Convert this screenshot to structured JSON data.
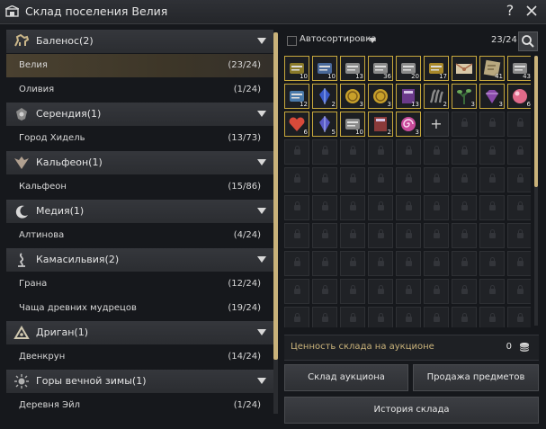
{
  "window": {
    "title": "Склад поселения Велия"
  },
  "regions": [
    {
      "name": "Баленос(2)",
      "icon": "horse-icon",
      "towns": [
        {
          "name": "Велия",
          "count": "(23/24)",
          "selected": true
        },
        {
          "name": "Оливия",
          "count": "(1/24)"
        }
      ]
    },
    {
      "name": "Серендия(1)",
      "icon": "crest-icon",
      "towns": [
        {
          "name": "Город Хидель",
          "count": "(13/73)"
        }
      ]
    },
    {
      "name": "Кальфеон(1)",
      "icon": "eagle-icon",
      "towns": [
        {
          "name": "Кальфеон",
          "count": "(15/86)"
        }
      ]
    },
    {
      "name": "Медия(1)",
      "icon": "moon-icon",
      "towns": [
        {
          "name": "Алтинова",
          "count": "(4/24)"
        }
      ]
    },
    {
      "name": "Камасильвия(2)",
      "icon": "tree-icon",
      "towns": [
        {
          "name": "Грана",
          "count": "(12/24)"
        },
        {
          "name": "Чаща древних мудрецов",
          "count": "(19/24)"
        }
      ]
    },
    {
      "name": "Дриган(1)",
      "icon": "triangle-icon",
      "towns": [
        {
          "name": "Двенкрун",
          "count": "(14/24)"
        }
      ]
    },
    {
      "name": "Горы вечной зимы(1)",
      "icon": "sun-icon",
      "towns": [
        {
          "name": "Деревня Эйл",
          "count": "(1/24)"
        }
      ]
    }
  ],
  "storage": {
    "sort_label": "Автосортировка",
    "count": "23/24",
    "items": [
      {
        "icon": "scroll-icon",
        "qty": "10",
        "color": "#8a7a2a"
      },
      {
        "icon": "scroll-icon",
        "qty": "10",
        "color": "#4a6a9a"
      },
      {
        "icon": "scroll-icon",
        "qty": "13",
        "color": "#8a8a8a"
      },
      {
        "icon": "scroll-icon",
        "qty": "36",
        "color": "#8a8a8a"
      },
      {
        "icon": "scroll-icon",
        "qty": "20",
        "color": "#8a8a8a"
      },
      {
        "icon": "scroll-icon",
        "qty": "17",
        "color": "#a8882a"
      },
      {
        "icon": "letter-icon",
        "qty": "",
        "color": "#a86a4a"
      },
      {
        "icon": "map-icon",
        "qty": "41",
        "color": "#b8a880"
      },
      {
        "icon": "scroll-icon",
        "qty": "43",
        "color": "#8a8a8a"
      },
      {
        "icon": "scroll-icon",
        "qty": "12",
        "color": "#4a7aaa"
      },
      {
        "icon": "crystal-icon",
        "qty": "2",
        "color": "#3a5aca"
      },
      {
        "icon": "coin-icon",
        "qty": "3",
        "color": "#c8a02a"
      },
      {
        "icon": "coin-icon",
        "qty": "3",
        "color": "#c8a02a"
      },
      {
        "icon": "book-icon",
        "qty": "13",
        "color": "#6a3a8a"
      },
      {
        "icon": "claw-icon",
        "qty": "2",
        "color": "#8a8a8a"
      },
      {
        "icon": "herb-icon",
        "qty": "3",
        "color": "#3a6a3a"
      },
      {
        "icon": "gem-icon",
        "qty": "3",
        "color": "#8a4aaa"
      },
      {
        "icon": "orb-icon",
        "qty": "6",
        "color": "#e06a8a"
      },
      {
        "icon": "heart-icon",
        "qty": "6",
        "color": "#d84a3a"
      },
      {
        "icon": "crystal-icon",
        "qty": "5",
        "color": "#5a5ac8"
      },
      {
        "icon": "scroll-icon",
        "qty": "10",
        "color": "#8a8a8a"
      },
      {
        "icon": "book-icon",
        "qty": "2",
        "color": "#8a3a3a"
      },
      {
        "icon": "swirl-icon",
        "qty": "3",
        "color": "#c84a9a"
      }
    ],
    "empty_slots": 1,
    "locked_rows": 7,
    "value_label": "Ценность склада на аукционе",
    "value": "0"
  },
  "buttons": {
    "auction_storage": "Склад аукциона",
    "sell_items": "Продажа предметов",
    "history": "История склада"
  }
}
